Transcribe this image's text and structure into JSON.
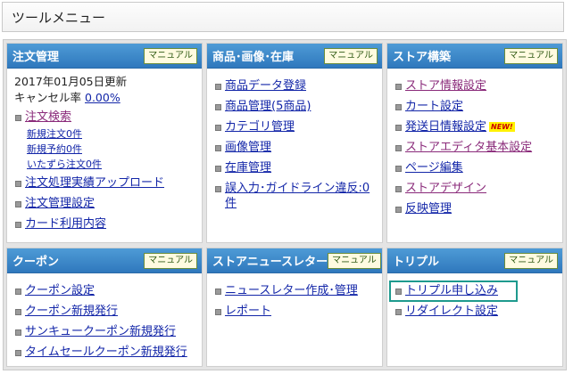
{
  "title": "ツールメニュー",
  "manual_label": "マニュアル",
  "new_badge": "NEW!",
  "colors": {
    "header": "#3a86c8",
    "link": "#1326a8",
    "visited": "#8a2a7a",
    "highlight": "#1e9a8e",
    "badge": "#fff200"
  },
  "panels": {
    "order": {
      "title": "注文管理",
      "date": "2017年01月05日更新",
      "cancel_label": "キャンセル率",
      "cancel_value": "0.00%",
      "search": "注文検索",
      "sub": [
        "新規注文0件",
        "新規予約0件",
        "いたずら注文0件"
      ],
      "links": [
        "注文処理実績アップロード",
        "注文管理設定",
        "カード利用内容"
      ]
    },
    "product": {
      "title": "商品･画像･在庫",
      "links": [
        "商品データ登録",
        "商品管理(5商品)",
        "カテゴリ管理",
        "画像管理",
        "在庫管理",
        "誤入力･ガイドライン違反:0件"
      ]
    },
    "store": {
      "title": "ストア構築",
      "links": [
        "ストア情報設定",
        "カート設定",
        "発送日情報設定",
        "ストアエディタ基本設定",
        "ページ編集",
        "ストアデザイン",
        "反映管理"
      ]
    },
    "coupon": {
      "title": "クーポン",
      "links": [
        "クーポン設定",
        "クーポン新規発行",
        "サンキュークーポン新規発行",
        "タイムセールクーポン新規発行"
      ]
    },
    "newsletter": {
      "title": "ストアニュースレター",
      "links": [
        "ニュースレター作成･管理",
        "レポート"
      ]
    },
    "trouble": {
      "title": "トリプル",
      "links": [
        "トリプル申し込み",
        "リダイレクト設定"
      ]
    }
  }
}
